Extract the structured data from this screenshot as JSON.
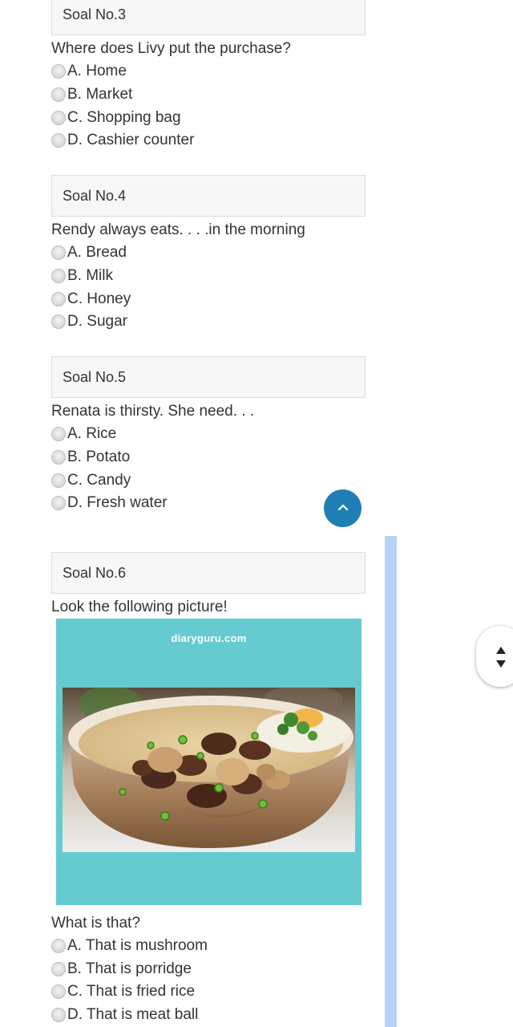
{
  "questions": [
    {
      "header": "Soal No.3",
      "text": "Where does Livy put the purchase?",
      "options": [
        "A. Home",
        "B. Market",
        "C. Shopping bag",
        "D. Cashier counter"
      ]
    },
    {
      "header": "Soal No.4",
      "text": "Rendy always eats. . . .in the morning",
      "options": [
        "A. Bread",
        "B. Milk",
        "C. Honey",
        "D. Sugar"
      ]
    },
    {
      "header": "Soal No.5",
      "text": "Renata is thirsty. She need. . .",
      "options": [
        "A. Rice",
        "B. Potato",
        "C. Candy",
        "D. Fresh water"
      ]
    },
    {
      "header": "Soal No.6",
      "intro": "Look the following picture!",
      "image_watermark": "diaryguru.com",
      "image_subject": "bowl of porridge with beef, mushrooms, egg and green onions",
      "text": "What is that?",
      "options": [
        "A. That is mushroom",
        "B. That is porridge",
        "C. That is fried rice",
        "D. That is meat ball"
      ]
    }
  ],
  "icons": {
    "scroll_top": "chevron-up-icon",
    "page_scroll": "up-down-arrows-icon"
  },
  "colors": {
    "accent": "#1f7fb5",
    "image_background": "#65cbd0",
    "scrollbar": "#b6d3f7"
  }
}
